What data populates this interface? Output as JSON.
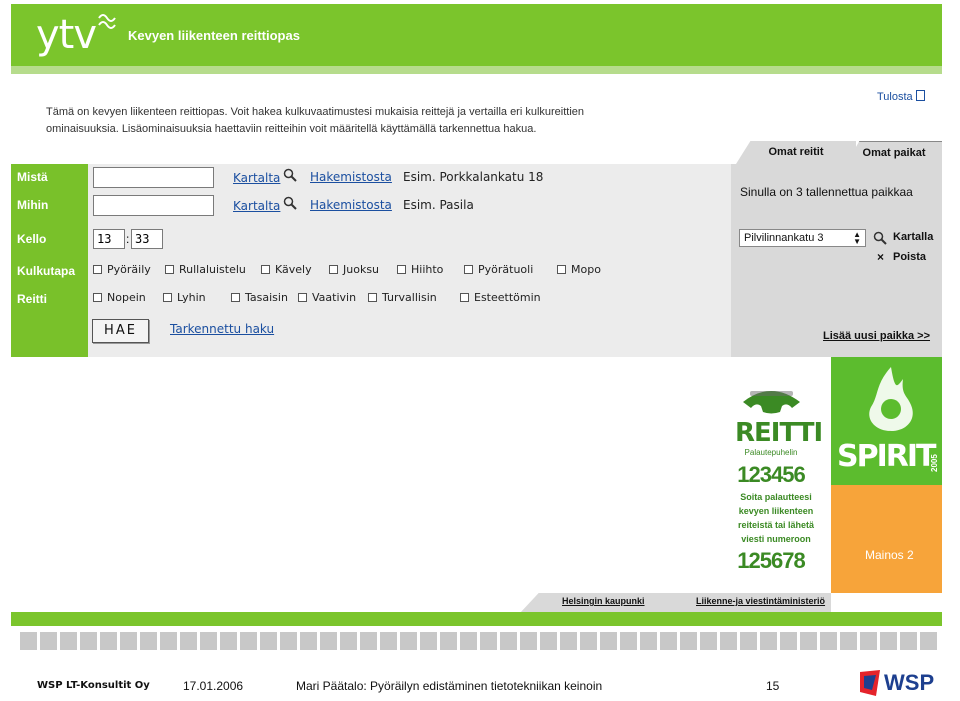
{
  "header": {
    "logo": "ytv",
    "title": "Kevyen liikenteen reittiopas"
  },
  "intro": {
    "line1": "Tämä on kevyen liikenteen reittiopas. Voit hakea kulkuvaatimustesi mukaisia reittejä ja vertailla eri kulkureittien",
    "line2": "ominaisuuksia. Lisäominaisuuksia haettaviin reitteihin voit määritellä käyttämällä tarkennettua hakua.",
    "print_label": "Tulosta"
  },
  "form": {
    "from_label": "Mistä",
    "to_label": "Mihin",
    "time_label": "Kello",
    "mode_label": "Kulkutapa",
    "route_label": "Reitti",
    "from_value": "",
    "to_value": "",
    "hour": "13",
    "minute": "33",
    "map_link": "Kartalta",
    "directory_link": "Hakemistosta",
    "from_example": "Esim. Porkkalankatu 18",
    "to_example": "Esim. Pasila",
    "modes": [
      "Pyöräily",
      "Rullaluistelu",
      "Kävely",
      "Juoksu",
      "Hiihto",
      "Pyörätuoli",
      "Mopo"
    ],
    "route_options": [
      "Nopein",
      "Lyhin",
      "Tasaisin",
      "Vaativin",
      "Turvallisin",
      "Esteettömin"
    ],
    "search_button": "HAE",
    "advanced_link": "Tarkennettu haku"
  },
  "right_panel": {
    "tab_routes": "Omat reitit",
    "tab_places": "Omat paikat",
    "saved_info": "Sinulla on 3 tallennettua paikkaa",
    "selected_place": "Pilvilinnankatu 3",
    "map_label": "Kartalla",
    "delete_label": "Poista",
    "add_place": "Lisää uusi paikka >>"
  },
  "ads": {
    "reitti_title": "REITTI",
    "reitti_sub": "Palautepuhelin",
    "phone1": "123456",
    "reitti_text": [
      "Soita palautteesi",
      "kevyen liikenteen",
      "reiteistä tai lähetä",
      "viesti numeroon"
    ],
    "phone2": "125678",
    "spirit": "SPIRIT",
    "spirit_year": "2005",
    "mainos": "Mainos 2"
  },
  "footer_links": {
    "city": "Helsingin kaupunki",
    "ministry": "Liikenne-ja viestintäministeriö"
  },
  "slide_footer": {
    "company": "WSP LT-Konsultit Oy",
    "date": "17.01.2006",
    "title": "Mari Päätalo: Pyöräilyn edistäminen tietotekniikan keinoin",
    "page": "15",
    "logo": "WSP"
  },
  "colors": {
    "brand_green": "#7bc52c",
    "link_blue": "#1b4fa0",
    "ad_orange": "#f7a43a"
  }
}
